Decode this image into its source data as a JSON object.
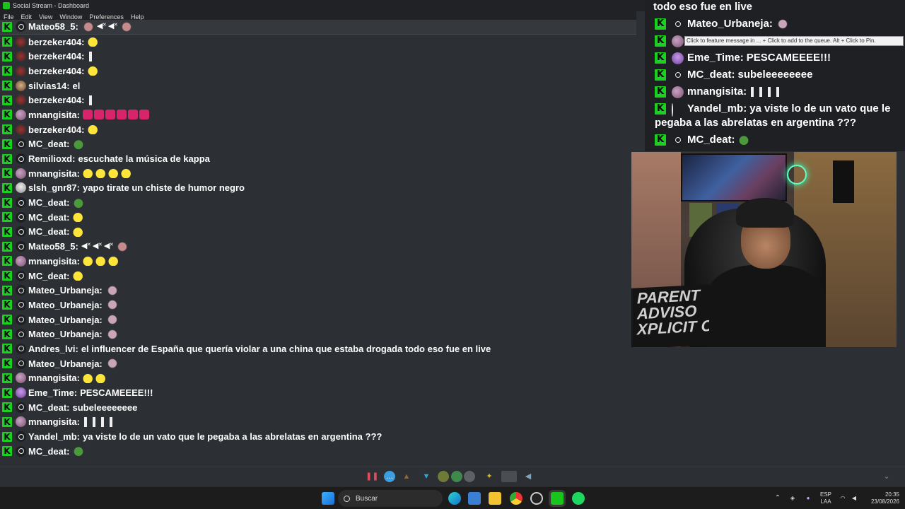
{
  "window": {
    "title": "Social Stream - Dashboard",
    "minimize": "—",
    "maximize": "▢",
    "close": "✕"
  },
  "menu": [
    "File",
    "Edit",
    "View",
    "Window",
    "Preferences",
    "Help"
  ],
  "chat": [
    {
      "user": "Mateo58_5:",
      "text": "",
      "avatar": "default",
      "emotes": [
        "dance",
        "speaker",
        "speaker",
        "dance"
      ],
      "highlight": true
    },
    {
      "user": "berzeker404:",
      "text": "",
      "avatar": "img-e",
      "emotes": [
        "yellow"
      ]
    },
    {
      "user": "berzeker404:",
      "text": "",
      "avatar": "img-e",
      "emotes": [
        "hand"
      ]
    },
    {
      "user": "berzeker404:",
      "text": "",
      "avatar": "img-e",
      "emotes": [
        "yellow"
      ]
    },
    {
      "user": "silvias14:",
      "text": "el",
      "avatar": "img-b",
      "emotes": []
    },
    {
      "user": "berzeker404:",
      "text": "",
      "avatar": "img-e",
      "emotes": [
        "hand"
      ]
    },
    {
      "user": "mnangisita:",
      "text": "",
      "avatar": "img-a",
      "emotes": [
        "pink",
        "pink",
        "pink",
        "pink",
        "pink",
        "pink"
      ]
    },
    {
      "user": "berzeker404:",
      "text": "",
      "avatar": "img-e",
      "emotes": [
        "yellow"
      ]
    },
    {
      "user": "MC_deat:",
      "text": "",
      "avatar": "default",
      "emotes": [
        "pepe"
      ]
    },
    {
      "user": "Remilioxd:",
      "text": "escuchate la música de kappa",
      "avatar": "default",
      "emotes": []
    },
    {
      "user": "mnangisita:",
      "text": "",
      "avatar": "img-a",
      "emotes": [
        "yellow",
        "yellow",
        "yellow",
        "yellow"
      ]
    },
    {
      "user": "slsh_gnr87:",
      "text": "yapo tirate un chiste de humor negro",
      "avatar": "img-d",
      "emotes": []
    },
    {
      "user": "MC_deat:",
      "text": "",
      "avatar": "default",
      "emotes": [
        "pepe"
      ]
    },
    {
      "user": "MC_deat:",
      "text": "",
      "avatar": "default",
      "emotes": [
        "yellow"
      ]
    },
    {
      "user": "MC_deat:",
      "text": "",
      "avatar": "default",
      "emotes": [
        "yellow"
      ]
    },
    {
      "user": "Mateo58_5:",
      "text": "",
      "avatar": "default",
      "emotes": [
        "speaker",
        "speaker",
        "speaker",
        "dance"
      ]
    },
    {
      "user": "mnangisita:",
      "text": "",
      "avatar": "img-a",
      "emotes": [
        "yellow",
        "yellow",
        "yellow"
      ]
    },
    {
      "user": "MC_deat:",
      "text": "",
      "avatar": "default",
      "emotes": [
        "yellow"
      ]
    },
    {
      "user": "Mateo_Urbaneja:",
      "text": "",
      "avatar": "default",
      "emotes": [
        "cat"
      ]
    },
    {
      "user": "Mateo_Urbaneja:",
      "text": "",
      "avatar": "default",
      "emotes": [
        "cat"
      ]
    },
    {
      "user": "Mateo_Urbaneja:",
      "text": "",
      "avatar": "default",
      "emotes": [
        "cat"
      ]
    },
    {
      "user": "Mateo_Urbaneja:",
      "text": "",
      "avatar": "default",
      "emotes": [
        "cat"
      ]
    },
    {
      "user": "Andres_lvi:",
      "text": "el influencer de España que quería violar a una china que estaba drogada todo eso fue en live",
      "avatar": "default",
      "emotes": []
    },
    {
      "user": "Mateo_Urbaneja:",
      "text": "",
      "avatar": "default",
      "emotes": [
        "cat"
      ]
    },
    {
      "user": "mnangisita:",
      "text": "",
      "avatar": "img-a",
      "emotes": [
        "yellow",
        "yellow"
      ]
    },
    {
      "user": "Eme_Time:",
      "text": "PESCAMEEEE!!!",
      "avatar": "img-c",
      "emotes": []
    },
    {
      "user": "MC_deat:",
      "text": "subeleeeeeeee",
      "avatar": "default",
      "emotes": []
    },
    {
      "user": "mnangisita:",
      "text": "",
      "avatar": "img-a",
      "emotes": [
        "hand",
        "hand",
        "hand",
        "hand"
      ]
    },
    {
      "user": "Yandel_mb:",
      "text": "ya viste lo de un vato que le pegaba a las abrelatas en argentina ???",
      "avatar": "default",
      "emotes": []
    },
    {
      "user": "MC_deat:",
      "text": "",
      "avatar": "default",
      "emotes": [
        "pepe"
      ]
    }
  ],
  "overlay": {
    "top_text": "todo eso fue en live",
    "messages": [
      {
        "user": "Mateo_Urbaneja:",
        "text": "",
        "avatar": "default",
        "emotes": [
          "cat"
        ]
      },
      {
        "user": "mnangisita:",
        "text": "",
        "avatar": "img-a",
        "emotes": [
          "yellow",
          "yellow"
        ]
      },
      {
        "user": "Eme_Time:",
        "text": "PESCAMEEEE!!!",
        "avatar": "img-c",
        "emotes": []
      },
      {
        "user": "MC_deat:",
        "text": "subeleeeeeeee",
        "avatar": "default",
        "emotes": []
      },
      {
        "user": "mnangisita:",
        "text": "",
        "avatar": "img-a",
        "emotes": [
          "hand",
          "hand",
          "hand",
          "hand"
        ]
      },
      {
        "user": "Yandel_mb:",
        "text": "ya viste lo de un vato que le pegaba a las abrelatas en argentina ???",
        "avatar": "default",
        "emotes": []
      },
      {
        "user": "MC_deat:",
        "text": "",
        "avatar": "default",
        "emotes": [
          "pepe"
        ]
      }
    ],
    "tooltip": "Click to feature message in ... + Click to add to the queue. Alt + Click to Pin."
  },
  "webcam": {
    "shirt_text": "PARENT\nADVISO\nXPLICIT CON"
  },
  "taskbar": {
    "search_placeholder": "Buscar",
    "lang_line1": "ESP",
    "lang_line2": "LAA",
    "time": "20:35",
    "date": "23/08/2026"
  }
}
